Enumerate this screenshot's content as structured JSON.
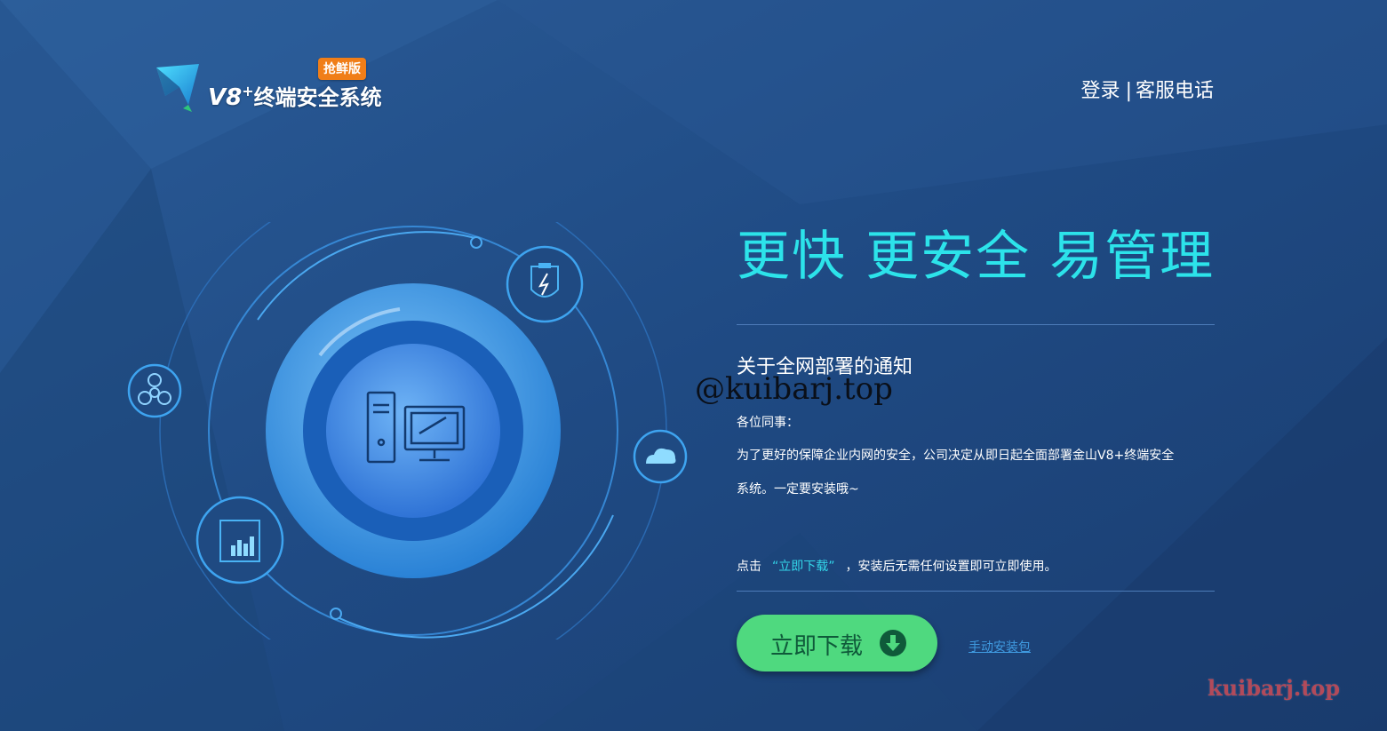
{
  "colors": {
    "background": "#1f4a82",
    "accent_cyan": "#2ce3ea",
    "button_green": "#4fd97f",
    "link_blue": "#3f9ae0",
    "badge_orange": "#f07e18"
  },
  "header": {
    "logo_name": "V8",
    "logo_plus": "+",
    "logo_subtitle": "终端安全系统",
    "logo_badge": "抢鲜版",
    "login": "登录",
    "separator": "|",
    "service_phone": "客服电话"
  },
  "illustration": {
    "icons": [
      "biohazard-icon",
      "usb-shield-icon",
      "cloud-icon",
      "analytics-chart-icon",
      "computer-icon"
    ]
  },
  "main": {
    "slogan": "更快 更安全 易管理",
    "notice_title": "关于全网部署的通知",
    "watermark_handle": "@kuibarj.top",
    "greeting": "各位同事：",
    "body_line1": "为了更好的保障企业内网的安全，公司决定从即日起全面部署金山V8+终端安全",
    "body_line2": "系统。一定要安装哦~",
    "hint_prefix": "点击",
    "hint_highlight": "“立即下载”",
    "hint_suffix": "，安装后无需任何设置即可立即使用。",
    "download_button": "立即下载",
    "manual_install_link": "手动安装包"
  },
  "watermark": "kuibarj.top"
}
